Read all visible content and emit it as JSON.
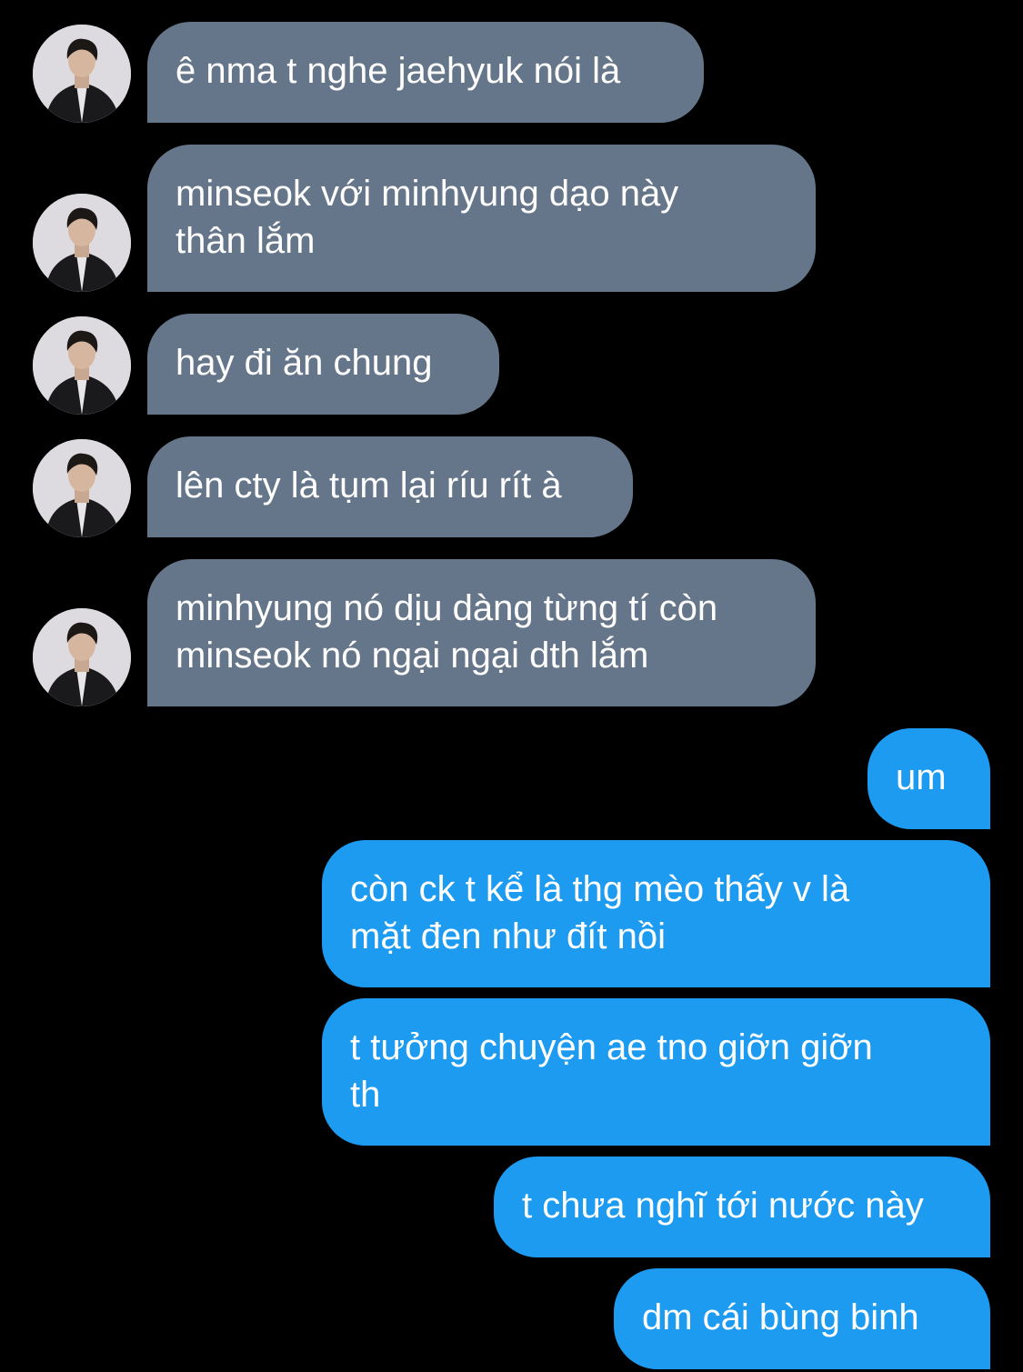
{
  "colors": {
    "background": "#000000",
    "incoming_bubble": "#66768a",
    "outgoing_bubble": "#1d9bf0",
    "text": "#ffffff"
  },
  "incoming_avatar": "profile-photo-avatar",
  "messages": [
    {
      "direction": "incoming",
      "text": "ê nma t nghe jaehyuk nói là"
    },
    {
      "direction": "incoming",
      "text": "minseok với minhyung dạo này\nthân lắm"
    },
    {
      "direction": "incoming",
      "text": "hay đi ăn chung"
    },
    {
      "direction": "incoming",
      "text": "lên cty là tụm lại ríu rít à"
    },
    {
      "direction": "incoming",
      "text": "minhyung nó dịu dàng từng tí còn\nminseok nó ngại ngại dth lắm"
    },
    {
      "direction": "outgoing",
      "text": "um"
    },
    {
      "direction": "outgoing",
      "text": "còn ck t kể là thg mèo thấy v là\nmặt đen như đít nồi"
    },
    {
      "direction": "outgoing",
      "text": "t tưởng chuyện ae tno giỡn giỡn\nth"
    },
    {
      "direction": "outgoing",
      "text": "t chưa nghĩ tới nước này"
    },
    {
      "direction": "outgoing",
      "text": "dm cái bùng binh"
    }
  ]
}
